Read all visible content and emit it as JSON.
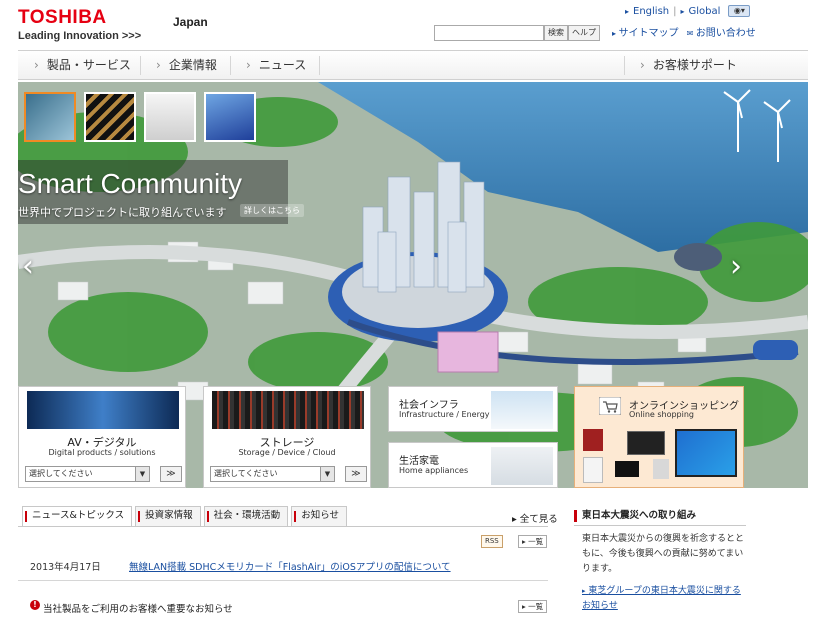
{
  "header": {
    "brand": "TOSHIBA",
    "tagline": "Leading Innovation >>>",
    "region": "Japan",
    "search_button": "検索",
    "help_button": "ヘルプ",
    "lang_english": "English",
    "lang_global": "Global",
    "sitemap": "サイトマップ",
    "contact": "お問い合わせ"
  },
  "nav": {
    "items": [
      "製品・サービス",
      "企業情報",
      "ニュース"
    ],
    "support": "お客様サポート"
  },
  "hero": {
    "title": "Smart Community",
    "subtitle": "世界中でプロジェクトに取り組んでいます",
    "more": "詳しくはこちら",
    "prev_arrow": "‹",
    "next_arrow": "›"
  },
  "products": [
    {
      "title": "AV・デジタル",
      "subtitle": "Digital products / solutions",
      "select": "選択してください",
      "go": "≫"
    },
    {
      "title": "ストレージ",
      "subtitle": "Storage / Device / Cloud",
      "select": "選択してください",
      "go": "≫"
    }
  ],
  "small_boxes": [
    {
      "title": "社会インフラ",
      "subtitle": "Infrastructure / Energy"
    },
    {
      "title": "生活家電",
      "subtitle": "Home appliances"
    }
  ],
  "shop": {
    "title": "オンラインショッピング",
    "subtitle": "Online shopping"
  },
  "tabs": [
    "ニュース&トピックス",
    "投資家情報",
    "社会・環境活動",
    "お知らせ"
  ],
  "show_all": "▸ 全て見る",
  "rss": "RSS",
  "list_button": "▸ 一覧",
  "news": [
    {
      "date": "2013年4月17日",
      "title": "無線LAN搭載 SDHCメモリカード「FlashAir」のiOSアプリの配信について"
    }
  ],
  "notice": {
    "title": "当社製品をご利用のお客様へ重要なお知らせ",
    "icon": "!"
  },
  "earthquake": {
    "heading": "東日本大震災への取り組み",
    "body": "東日本大震災からの復興を祈念するとともに、今後も復興への貢献に努めてまいります。",
    "link": "東芝グループの東日本大震災に関するお知らせ",
    "bullet": "▸"
  }
}
